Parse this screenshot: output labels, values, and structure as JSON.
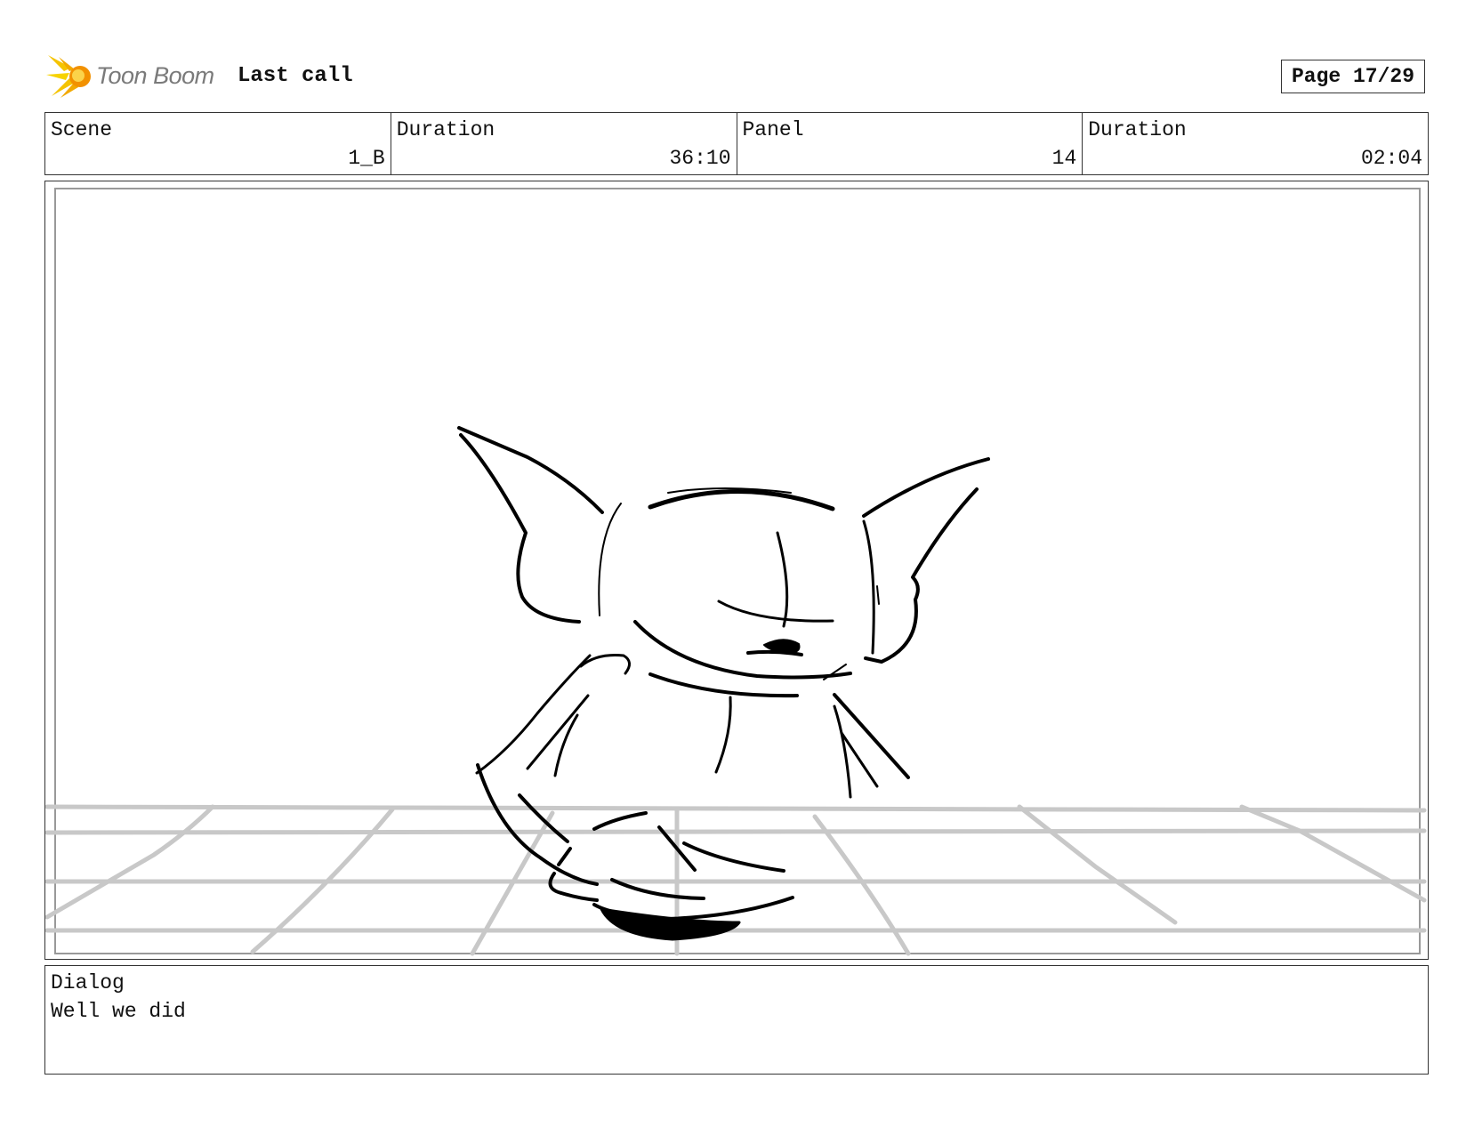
{
  "header": {
    "brand": "Toon Boom",
    "title": "Last call",
    "page": "Page 17/29"
  },
  "info": [
    {
      "label": "Scene",
      "value": "1_B"
    },
    {
      "label": "Duration",
      "value": "36:10"
    },
    {
      "label": "Panel",
      "value": "14"
    },
    {
      "label": "Duration",
      "value": "02:04"
    }
  ],
  "dialog": {
    "label": "Dialog",
    "text": "Well we did"
  },
  "colors": {
    "logo_yellow": "#f5c400",
    "logo_orange": "#f29100",
    "grid_gray": "#c8c8c8",
    "ink": "#000000"
  }
}
